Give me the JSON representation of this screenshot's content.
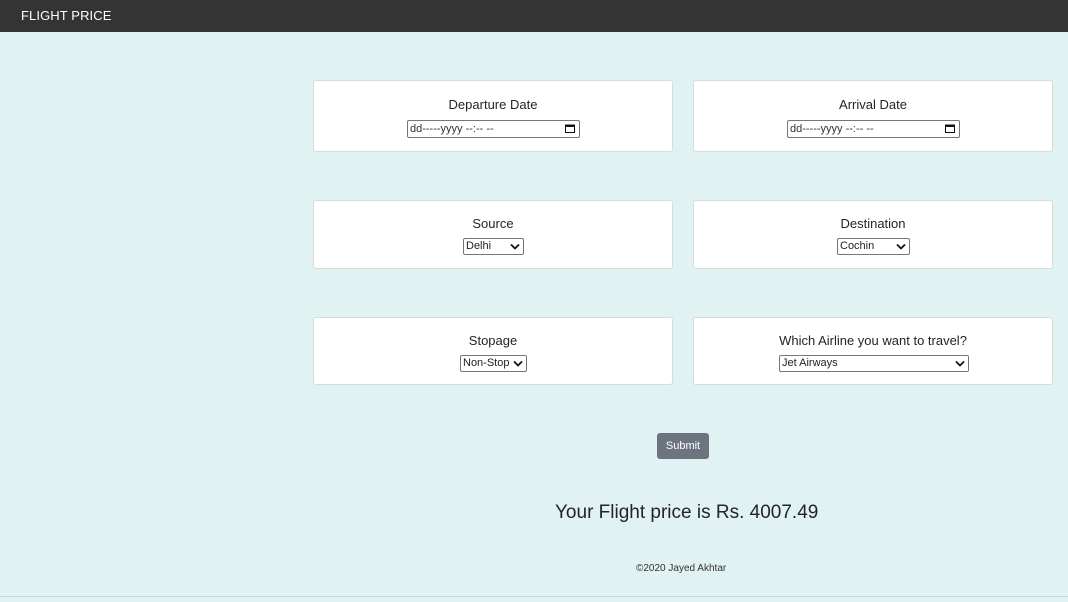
{
  "navbar": {
    "brand": "FLIGHT PRICE"
  },
  "form": {
    "departure": {
      "label": "Departure Date",
      "placeholder": "dd-----yyyy --:-- --"
    },
    "arrival": {
      "label": "Arrival Date",
      "placeholder": "dd-----yyyy --:-- --"
    },
    "source": {
      "label": "Source",
      "selected": "Delhi"
    },
    "destination": {
      "label": "Destination",
      "selected": "Cochin"
    },
    "stopage": {
      "label": "Stopage",
      "selected": "Non-Stop"
    },
    "airline": {
      "label": "Which Airline you want to travel?",
      "selected": "Jet Airways"
    },
    "submit_label": "Submit"
  },
  "result": {
    "text": "Your Flight price is Rs. 4007.49"
  },
  "footer": {
    "text": "©2020 Jayed Akhtar"
  },
  "icons": {
    "calendar": "calendar-icon",
    "chevron": "chevron-down-icon"
  },
  "colors": {
    "navbar": "#343434",
    "background": "#e0f2f1",
    "submit": "#6c757d"
  }
}
